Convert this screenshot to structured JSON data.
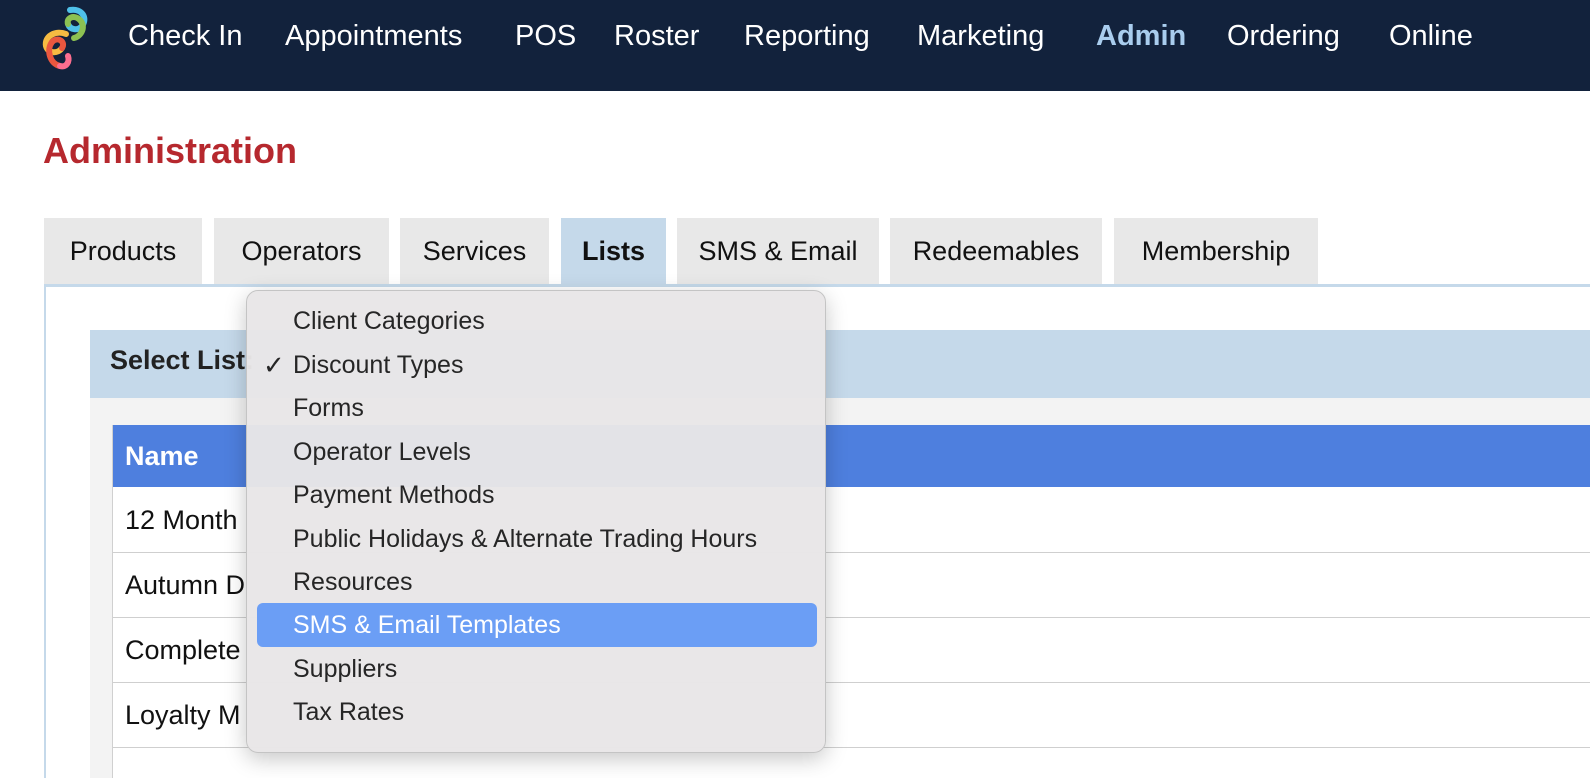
{
  "nav": {
    "items": [
      {
        "label": "Check In",
        "active": false
      },
      {
        "label": "Appointments",
        "active": false
      },
      {
        "label": "POS",
        "active": false
      },
      {
        "label": "Roster",
        "active": false
      },
      {
        "label": "Reporting",
        "active": false
      },
      {
        "label": "Marketing",
        "active": false
      },
      {
        "label": "Admin",
        "active": true
      },
      {
        "label": "Ordering",
        "active": false
      },
      {
        "label": "Online",
        "active": false
      }
    ],
    "logo_colors": [
      "#4fc1e9",
      "#8cc152",
      "#f6bb42",
      "#e9573f",
      "#fc6e8f"
    ]
  },
  "page": {
    "title": "Administration"
  },
  "tabs": [
    {
      "label": "Products",
      "active": false
    },
    {
      "label": "Operators",
      "active": false
    },
    {
      "label": "Services",
      "active": false
    },
    {
      "label": "Lists",
      "active": true
    },
    {
      "label": "SMS & Email",
      "active": false
    },
    {
      "label": "Redeemables",
      "active": false
    },
    {
      "label": "Membership",
      "active": false
    }
  ],
  "select_list": {
    "label": "Select List:"
  },
  "table": {
    "header": "Name",
    "rows": [
      "12 Month",
      "Autumn D",
      "Complete",
      "Loyalty M"
    ]
  },
  "dropdown": {
    "selected": "Discount Types",
    "highlighted": "SMS & Email Templates",
    "check_glyph": "✓",
    "options": [
      "Client Categories",
      "Discount Types",
      "Forms",
      "Operator Levels",
      "Payment Methods",
      "Public Holidays & Alternate Trading Hours",
      "Resources",
      "SMS & Email Templates",
      "Suppliers",
      "Tax Rates"
    ]
  },
  "colors": {
    "nav_bg": "#12223c",
    "nav_active": "#a9cdee",
    "title_red": "#b6282e",
    "tab_active_bg": "#c5d9ea",
    "table_header_bg": "#4e7fde",
    "menu_highlight": "#6b9ef5"
  }
}
